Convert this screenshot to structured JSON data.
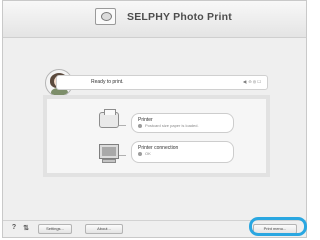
{
  "app": {
    "title": "SELPHY Photo Print"
  },
  "status": {
    "text": "Ready to print.",
    "indicators": "◀) ⊖ ◎ ☐"
  },
  "cards": {
    "printer": {
      "title": "Printer",
      "status": "Postcard size paper is loaded."
    },
    "connection": {
      "title": "Printer connection",
      "status": "OK"
    }
  },
  "footer": {
    "help_label": "?",
    "tools_label": "⇅",
    "settings_label": "Settings...",
    "about_label": "About...",
    "print_menu_label": "Print menu..."
  },
  "colors": {
    "highlight": "#2aa7e1",
    "header_title": "#4d4d4d"
  }
}
